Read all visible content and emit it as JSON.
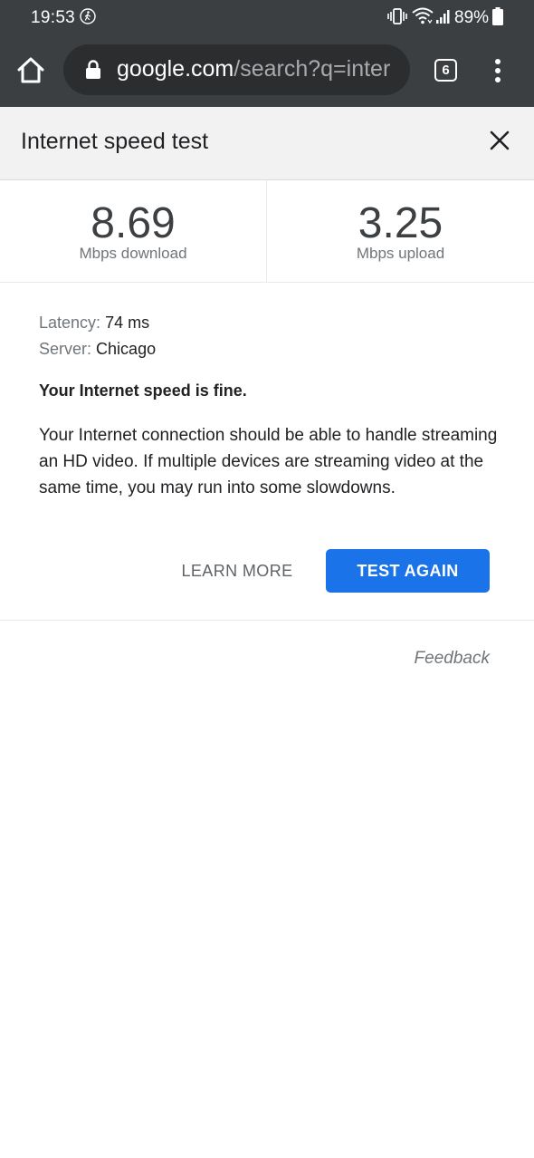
{
  "status_bar": {
    "time": "19:53",
    "battery": "89%"
  },
  "toolbar": {
    "url_domain": "google.com",
    "url_path": "/search?q=inter",
    "tab_count": "6"
  },
  "panel": {
    "title": "Internet speed test",
    "download": {
      "value": "8.69",
      "unit": "Mbps download"
    },
    "upload": {
      "value": "3.25",
      "unit": "Mbps upload"
    },
    "latency": {
      "label": "Latency:",
      "value": "74 ms"
    },
    "server": {
      "label": "Server:",
      "value": "Chicago"
    },
    "verdict": "Your Internet speed is fine.",
    "description": "Your Internet connection should be able to handle streaming an HD video. If multiple devices are streaming video at the same time, you may run into some slowdowns.",
    "learn_more_label": "LEARN MORE",
    "test_again_label": "TEST AGAIN",
    "feedback_label": "Feedback"
  },
  "colors": {
    "chrome_toolbar": "#3c3f41",
    "accent": "#1a73e8"
  },
  "icons": [
    "walk-icon",
    "vibrate-icon",
    "wifi-icon",
    "signal-icon",
    "battery-icon",
    "home-icon",
    "lock-icon",
    "menu-icon",
    "close-icon"
  ]
}
